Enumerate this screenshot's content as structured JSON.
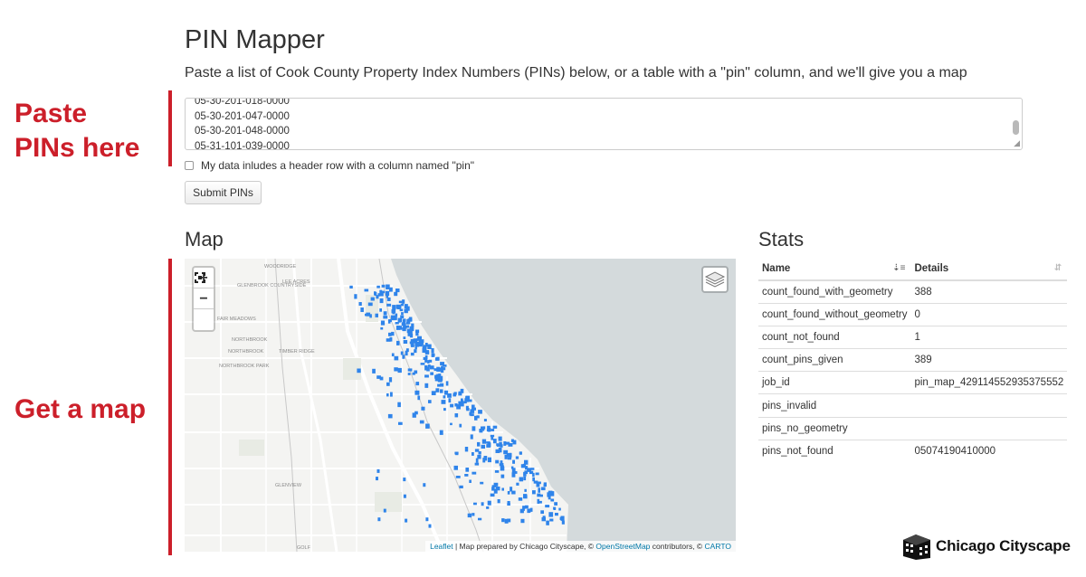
{
  "callouts": {
    "paste": "Paste\nPINs here",
    "map": "Get a map"
  },
  "page": {
    "title": "PIN Mapper",
    "subtitle": "Paste a list of Cook County Property Index Numbers (PINs) below, or a table with a \"pin\" column, and we'll give you a map"
  },
  "pin_input": {
    "lines": [
      "05-30-201-018-0000",
      "05-30-201-047-0000",
      "05-30-201-048-0000",
      "05-31-101-039-0000"
    ]
  },
  "header_checkbox": {
    "label": "My data inludes a header row with a column named \"pin\"",
    "checked": false
  },
  "submit_label": "Submit PINs",
  "map": {
    "heading": "Map",
    "zoom_in": "+",
    "zoom_out": "−",
    "place_labels": [
      "WOODRIDGE",
      "GLENBROOK COUNTRYSIDE",
      "LEE ACRES",
      "FAIR MEADOWS",
      "NORTHBROOK",
      "NORTHBROOK PARK",
      "TIMBER RIDGE",
      "NORTHBROOK",
      "GLENVIEW",
      "GOLF"
    ],
    "attribution": {
      "leaflet": "Leaflet",
      "text1": " | Map prepared by Chicago Cityscape, © ",
      "osm": "OpenStreetMap",
      "text2": " contributors, © ",
      "carto": "CARTO"
    },
    "colors": {
      "land": "#f4f4f2",
      "water": "#d4dadc",
      "road": "#ffffff",
      "marker": "#2f84ea"
    }
  },
  "stats": {
    "heading": "Stats",
    "columns": [
      "Name",
      "Details"
    ],
    "rows": [
      [
        "count_found_with_geometry",
        "388"
      ],
      [
        "count_found_without_geometry",
        "0"
      ],
      [
        "count_not_found",
        "1"
      ],
      [
        "count_pins_given",
        "389"
      ],
      [
        "job_id",
        "pin_map_429114552935375552"
      ],
      [
        "pins_invalid",
        ""
      ],
      [
        "pins_no_geometry",
        ""
      ],
      [
        "pins_not_found",
        "05074190410000"
      ]
    ]
  },
  "logo": {
    "text": "Chicago Cityscape",
    "icon": "building-icon"
  },
  "accent": "#cc1f2a"
}
